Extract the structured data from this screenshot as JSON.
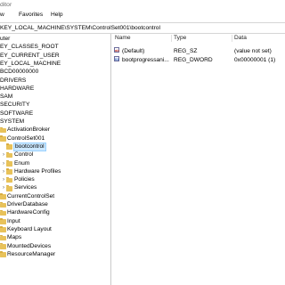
{
  "window": {
    "title": "ditor"
  },
  "menu": [
    "w",
    "Favorites",
    "Help"
  ],
  "address": "KEY_LOCAL_MACHINE\\SYSTEM\\ControlSet001\\bootcontrol",
  "tree": {
    "items": [
      {
        "label": "uter"
      },
      {
        "label": "EY_CLASSES_ROOT"
      },
      {
        "label": "EY_CURRENT_USER"
      },
      {
        "label": "EY_LOCAL_MACHINE"
      },
      {
        "label": "BCD00000000"
      },
      {
        "label": "DRIVERS"
      },
      {
        "label": "HARDWARE"
      },
      {
        "label": "SAM"
      },
      {
        "label": "SECURITY"
      },
      {
        "label": "SOFTWARE"
      },
      {
        "label": "SYSTEM"
      },
      {
        "label": "ActivationBroker"
      },
      {
        "label": "ControlSet001"
      },
      {
        "label": "bootcontrol",
        "selected": true
      },
      {
        "label": "Control"
      },
      {
        "label": "Enum"
      },
      {
        "label": "Hardware Profiles"
      },
      {
        "label": "Policies"
      },
      {
        "label": "Services"
      },
      {
        "label": "CurrentControlSet"
      },
      {
        "label": "DriverDatabase"
      },
      {
        "label": "HardwareConfig"
      },
      {
        "label": "Input"
      },
      {
        "label": "Keyboard Layout"
      },
      {
        "label": "Maps"
      },
      {
        "label": "MountedDevices"
      },
      {
        "label": "ResourceManager"
      }
    ]
  },
  "list": {
    "columns": {
      "name": "Name",
      "type": "Type",
      "data": "Data"
    },
    "rows": [
      {
        "name": "(Default)",
        "type": "REG_SZ",
        "data": "(value not set)",
        "icon": "ab"
      },
      {
        "name": "bootprogressani...",
        "type": "REG_DWORD",
        "data": "0x00000001 (1)",
        "icon": "01"
      }
    ]
  },
  "colors": {
    "folder": "#e8c25a",
    "selection": "#cce8ff"
  }
}
